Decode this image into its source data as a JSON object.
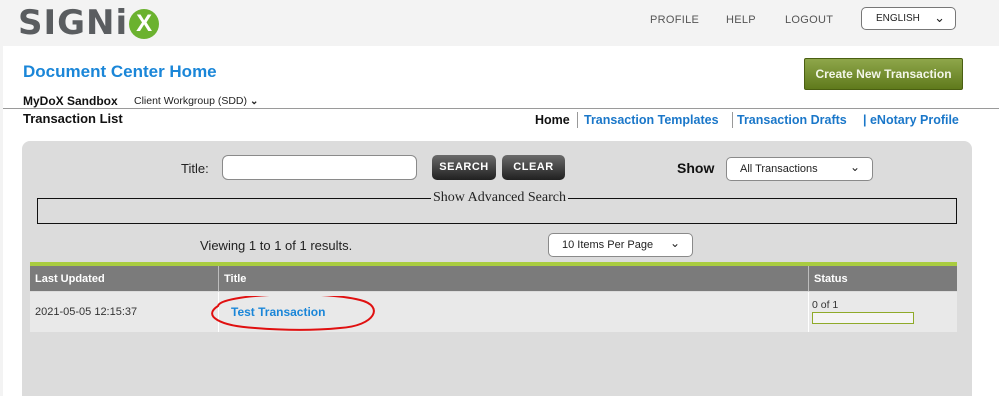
{
  "header": {
    "logo_text": "SIGNi",
    "logo_badge": "X",
    "links": {
      "profile": "PROFILE",
      "help": "HELP",
      "logout": "LOGOUT"
    },
    "language": "ENGLISH"
  },
  "page": {
    "title": "Document Center Home",
    "create_button": "Create New Transaction",
    "sandbox": "MyDoX Sandbox",
    "workgroup": "Client Workgroup (SDD)",
    "list_title": "Transaction List"
  },
  "nav": {
    "home": "Home",
    "templates": "Transaction Templates",
    "drafts": "Transaction Drafts",
    "enotary": "| eNotary Profile"
  },
  "search": {
    "title_label": "Title:",
    "title_value": "",
    "search_button": "SEARCH",
    "clear_button": "CLEAR",
    "show_label": "Show",
    "show_selected": "All Transactions",
    "advanced_label": "Show Advanced Search"
  },
  "results": {
    "viewing_text": "Viewing 1 to 1 of 1 results.",
    "per_page_selected": "10 Items Per Page"
  },
  "table": {
    "columns": [
      "Last Updated",
      "Title",
      "Status"
    ],
    "rows": [
      {
        "last_updated": "2021-05-05 12:15:37",
        "title": "Test Transaction",
        "status_text": "0 of 1",
        "progress": 0
      }
    ]
  },
  "colors": {
    "brand_blue": "#1a86d8",
    "accent_green": "#a9cc40",
    "create_button_green": "#6f8a26",
    "annotation_red": "#e01010"
  }
}
